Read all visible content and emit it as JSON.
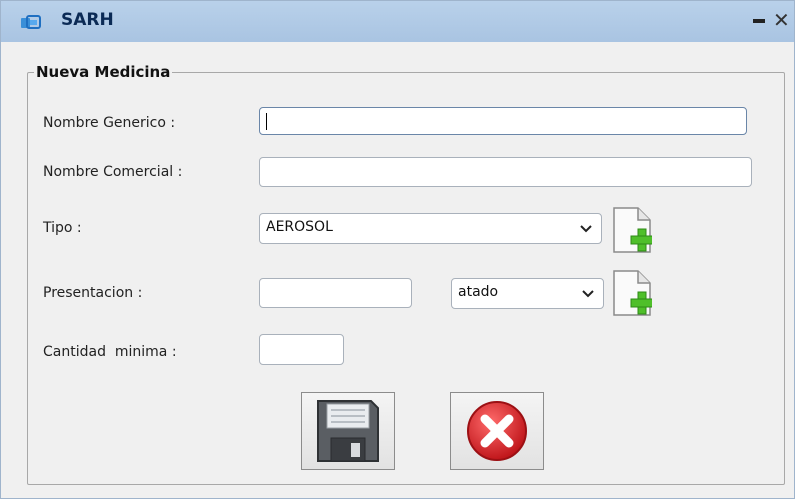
{
  "window": {
    "title": "SARH",
    "min_symbol": "_",
    "close_symbol": "✕"
  },
  "form": {
    "group_title": "Nueva Medicina",
    "nombre_generico": {
      "label": "Nombre Generico :",
      "value": ""
    },
    "nombre_comercial": {
      "label": "Nombre Comercial :",
      "value": ""
    },
    "tipo": {
      "label": "Tipo :",
      "selected": "AEROSOL"
    },
    "presentacion": {
      "label": "Presentacion :",
      "value": "",
      "unit_selected": "atado"
    },
    "cantidad_minima": {
      "label": "Cantidad  minima :",
      "value": ""
    }
  },
  "icons": {
    "app": "app-window-icon",
    "add": "add-document-icon",
    "save": "floppy-save-icon",
    "cancel": "red-x-cancel-icon"
  },
  "colors": {
    "titlebar": "#b9d1ea",
    "title_text": "#0b2a55",
    "cancel_red": "#d9262a",
    "add_green": "#4fbf2a"
  }
}
